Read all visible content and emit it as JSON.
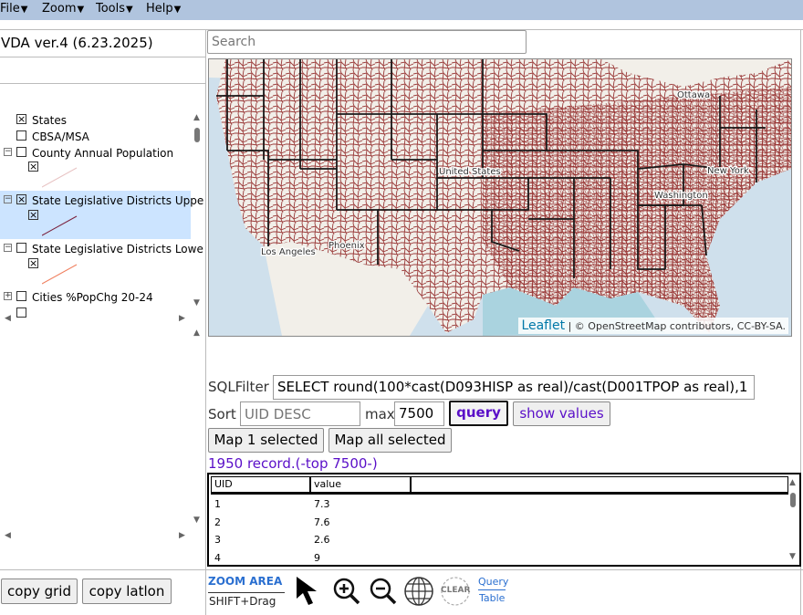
{
  "menubar": {
    "items": [
      {
        "label": "File"
      },
      {
        "label": "Zoom"
      },
      {
        "label": "Tools"
      },
      {
        "label": "Help"
      }
    ]
  },
  "app": {
    "title": "VDA ver.4 (6.23.2025)"
  },
  "search": {
    "placeholder": "Search",
    "value": ""
  },
  "layers": [
    {
      "label": "States",
      "checked": true
    },
    {
      "label": "CBSA/MSA",
      "checked": false
    },
    {
      "label": "County Annual Population",
      "checked": false
    },
    {
      "label": "State Legislative Districts Upper",
      "checked": true
    },
    {
      "label": "State Legislative Districts Lower",
      "checked": false
    },
    {
      "label": "Cities %PopChg 20-24",
      "checked": false
    }
  ],
  "map": {
    "attribution_link": "Leaflet",
    "attribution_text": "| © OpenStreetMap contributors, CC-BY-SA.",
    "place_labels": [
      "Ottawa",
      "United States",
      "New York",
      "Washington",
      "Los Angeles",
      "Phoenix"
    ]
  },
  "sql": {
    "label": "SQLFilter",
    "value": "SELECT round(100*cast(D093HISP as real)/cast(D001TPOP as real),1"
  },
  "sort": {
    "label": "Sort",
    "placeholder": "UID DESC",
    "max_label": "max",
    "max_value": "7500"
  },
  "buttons": {
    "query": "query",
    "show_values": "show values",
    "map_one": "Map 1 selected",
    "map_all": "Map all selected",
    "copy_grid": "copy grid",
    "copy_latlon": "copy latlon"
  },
  "records": "1950 record.(-top 7500-)",
  "grid": {
    "columns": [
      "UID",
      "value"
    ],
    "rows": [
      [
        "1",
        "7.3"
      ],
      [
        "2",
        "7.6"
      ],
      [
        "3",
        "2.6"
      ],
      [
        "4",
        "9"
      ]
    ]
  },
  "toolbar": {
    "zoom_area": "ZOOM AREA",
    "shift_drag": "SHIFT+Drag",
    "clear": "CLEAR",
    "query_table_1": "Query",
    "query_table_2": "Table"
  },
  "colors": {
    "menubar": "#b0c4de",
    "accent": "#5a0fc8",
    "district_lines": "#8b1a1a"
  }
}
